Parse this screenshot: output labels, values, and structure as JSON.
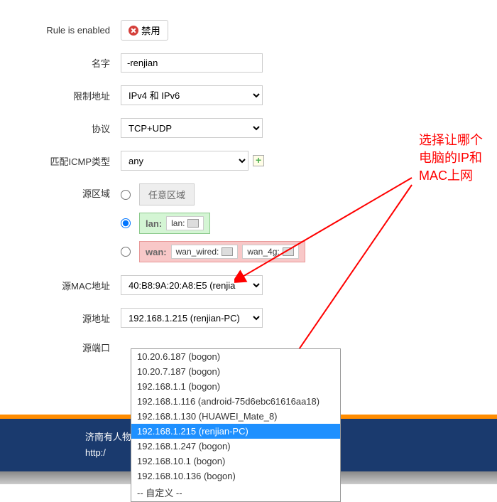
{
  "rule_enabled": {
    "label": "Rule is enabled",
    "button": "禁用"
  },
  "name": {
    "label": "名字",
    "value": "-renjian"
  },
  "restrict_addr": {
    "label": "限制地址",
    "value": "IPv4 和 IPv6"
  },
  "protocol": {
    "label": "协议",
    "value": "TCP+UDP"
  },
  "icmp": {
    "label": "匹配ICMP类型",
    "value": "any"
  },
  "source_zone": {
    "label": "源区域",
    "any": "任意区域",
    "lan": {
      "name": "lan:",
      "iface": "lan:"
    },
    "wan": {
      "name": "wan:",
      "iface1": "wan_wired:",
      "iface2": "wan_4g:"
    }
  },
  "source_mac": {
    "label": "源MAC地址",
    "value": "40:B8:9A:20:A8:E5 (renjia"
  },
  "source_addr": {
    "label": "源地址",
    "value": "192.168.1.215 (renjian-PC)"
  },
  "source_port": {
    "label": "源端口"
  },
  "dropdown_options": [
    "10.20.6.187 (bogon)",
    "10.20.7.187 (bogon)",
    "192.168.1.1 (bogon)",
    "192.168.1.116 (android-75d6ebc61616aa18)",
    "192.168.1.130 (HUAWEI_Mate_8)",
    "192.168.1.215 (renjian-PC)",
    "192.168.1.247 (bogon)",
    "192.168.10.1 (bogon)",
    "192.168.10.136 (bogon)",
    "-- 自定义 --"
  ],
  "dropdown_selected_index": 5,
  "annotation": {
    "line1": "选择让哪个",
    "line2": "电脑的IP和",
    "line3": "MAC上网"
  },
  "footer": {
    "line1": "济南有人物",
    "line2": "http:/"
  }
}
